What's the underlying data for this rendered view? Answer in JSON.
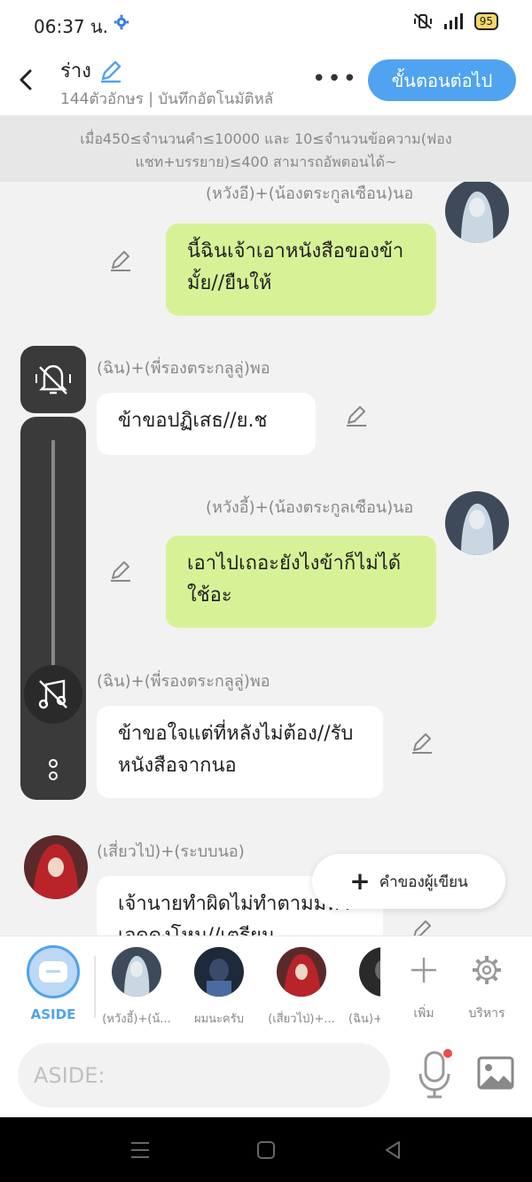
{
  "status_bar": {
    "time": "06:37 น.",
    "battery": "95"
  },
  "header": {
    "title": "ร่าง",
    "subtitle": "144ตัวอักษร | บันทึกอัตโนมัติหลั",
    "next_label": "ขั้นตอนต่อไป"
  },
  "notice": {
    "text": "เมื่อ450≤จำนวนคำ≤10000 และ 10≤จำนวนข้อความ(ฟองแชท+บรรยาย)≤400 สามารถอัพตอนได้~"
  },
  "messages": [
    {
      "side": "right",
      "name": "(หวังอี)+(น้องตระกูลเซือน)นอ",
      "text": "นี้ฉินเจ้าเอาหนังสือของข้ามั้ย//ยืนให้"
    },
    {
      "side": "left",
      "name": "(ฉิน)+(พี่รองตระกลูลู่)พอ",
      "text": "ข้าขอปฏิเสธ//ย.ช"
    },
    {
      "side": "right",
      "name": "(หวังอี้)+(น้องตระกูลเซือน)นอ",
      "text": "เอาไปเถอะยังไงข้าก็ไม่ได้ใช้อะ"
    },
    {
      "side": "left",
      "name": "(ฉิน)+(พี่รองตระกลูลู่)พอ",
      "text": "ข้าขอใจแต่ที่หลังไม่ต้อง//รับหนังสือจากนอ"
    },
    {
      "side": "left",
      "name": "(เสี่ยวไป่)+(ระบบนอ)",
      "text": "เจ้านายทำผิดไม่ทำตามมหาเจดดงโหม//เตรียม"
    }
  ],
  "writer_button": {
    "label": "คำของผู้เขียน"
  },
  "characters": {
    "aside_label": "ASIDE",
    "items": [
      {
        "name": "(หวังอี้)+(น้..."
      },
      {
        "name": "ผมนะครับ"
      },
      {
        "name": "(เสี่ยวไป่)+..."
      },
      {
        "name": "(ฉิน)+"
      }
    ],
    "add_label": "เพิ่ม",
    "manage_label": "บริหาร"
  },
  "input": {
    "placeholder": "ASIDE:"
  },
  "colors": {
    "accent": "#4fa3f0",
    "bubble_right": "#d7f296",
    "bubble_left": "#ffffff"
  }
}
